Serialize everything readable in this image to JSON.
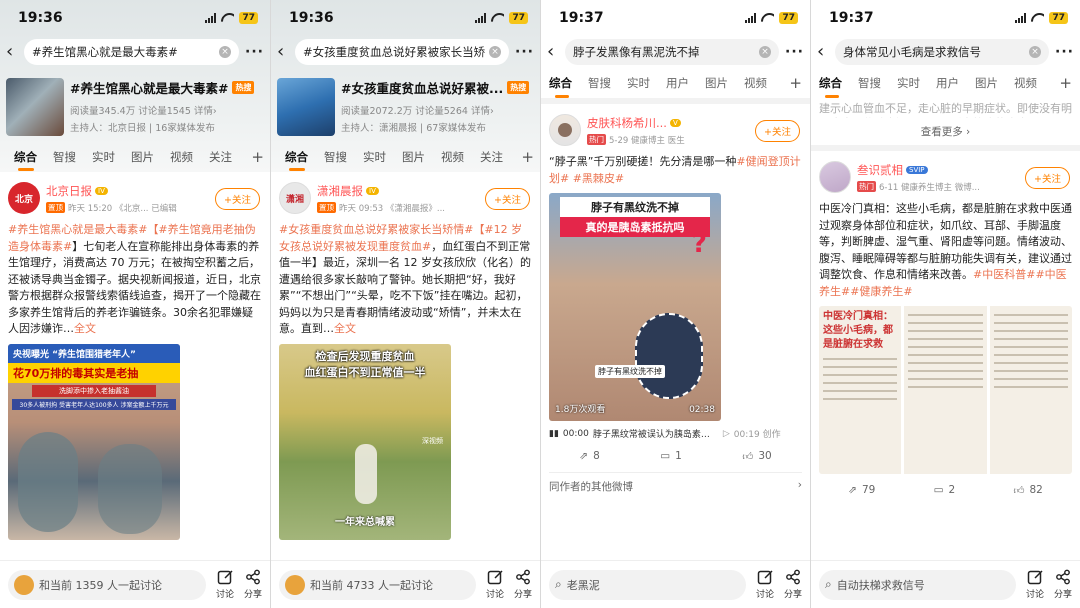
{
  "screens": [
    {
      "time": "19:36",
      "battery": "77",
      "search_query": "#养生馆黑心就是最大毒素#",
      "topic": {
        "title": "#养生馆黑心就是最大毒素#",
        "hot_label": "热搜",
        "stats": "阅读量345.4万  讨论量1545  详情›",
        "host": "主持人：北京日报 | 16家媒体发布"
      },
      "tabs": [
        "综合",
        "智搜",
        "实时",
        "图片",
        "视频",
        "关注"
      ],
      "post": {
        "author": "北京日报",
        "author_badge": "IV",
        "meta_tag": "置顶",
        "meta": "昨天 15:20 《北京... 已编辑",
        "follow_label": "+关注",
        "text_link1": "#养生馆黑心就是最大毒素#",
        "text_link2": "【#养生馆竟用老抽伪造身体毒素#",
        "text_body": "】七旬老人在宣称能排出身体毒素的养生馆理疗，消费高达 70 万元；在被掏空积蓄之后，还被诱导典当金镯子。据央视新闻报道，近日，北京警方根据群众报警线索循线追查，揭开了一个隐藏在多家养生馆背后的养老诈骗链条。30余名犯罪嫌疑人因涉嫌诈…",
        "fulltext": "全文",
        "image_title1": "央视曝光 “养生馆围猎老年人”",
        "image_title2": "花70万排的毒其实是老抽",
        "image_sub1": "洗脚添中掺入老抽酱油",
        "image_sub2": "30多人被刑拘 受害老年人达100多人 涉案金额上千万元"
      },
      "discuss": "和当前 1359 人一起讨论",
      "btn_discuss": "讨论",
      "btn_share": "分享"
    },
    {
      "time": "19:36",
      "battery": "77",
      "search_query": "#女孩重度贫血总说好累被家长当矫",
      "topic": {
        "title": "#女孩重度贫血总说好累被...",
        "hot_label": "热搜",
        "stats": "阅读量2072.2万  讨论量5264  详情›",
        "host": "主持人：潇湘晨报 | 67家媒体发布"
      },
      "tabs": [
        "综合",
        "智搜",
        "实时",
        "图片",
        "视频",
        "关注"
      ],
      "post": {
        "author": "潇湘晨报",
        "author_badge": "IV",
        "meta_tag": "置顶",
        "meta": "昨天 09:53 《潇湘晨报》...",
        "follow_label": "+关注",
        "text_link1": "#女孩重度贫血总说好累被家长当矫情#",
        "text_link2": "【#12 岁女孩总说好累被发现重度贫血#",
        "text_body": "，血红蛋白不到正常值一半】最近，深圳一名 12 岁女孩欣欣（化名）的遭遇给很多家长敲响了警钟。她长期把“好，我好累”“不想出门”“头晕，吃不下饭”挂在嘴边。起初，妈妈以为只是青春期情绪波动或“矫情”，并未太在意。直到…",
        "fulltext": "全文",
        "image_title1": "检查后发现重度贫血",
        "image_title2": "血红蛋白不到正常值一半",
        "image_caption": "一年来总喊累",
        "watermark": "深视频"
      },
      "discuss": "和当前 4733 人一起讨论",
      "btn_discuss": "讨论",
      "btn_share": "分享"
    },
    {
      "time": "19:37",
      "battery": "77",
      "search_query": "脖子发黑像有黑泥洗不掉",
      "tabs": [
        "综合",
        "智搜",
        "实时",
        "用户",
        "图片",
        "视频"
      ],
      "post": {
        "author": "皮肤科杨希川...",
        "meta_tag": "热门",
        "meta": "5-29  健康博主 医生",
        "follow_label": "+关注",
        "text_pre": "“脖子黑”千万别硬搓！先分清是哪一种",
        "text_link1": "#健闻登顶计划#",
        "text_link2": "#黑棘皮#",
        "video_title1": "脖子有黑纹洗不掉",
        "video_title2": "真的是胰岛素抵抗吗",
        "video_caption": "脖子有黑纹洗不掉",
        "views": "1.8万次观看",
        "duration": "02:38",
        "audio_time": "00:00",
        "audio_title": "脖子黑纹常被误认为胰岛素抵抗...",
        "audio_end": "00:19 创作",
        "reposts": "8",
        "comments": "1",
        "likes": "30"
      },
      "section": "同作者的其他微博",
      "search_placeholder": "老黑泥",
      "btn_discuss": "讨论",
      "btn_share": "分享"
    },
    {
      "time": "19:37",
      "battery": "77",
      "search_query": "身体常见小毛病是求救信号",
      "tabs": [
        "综合",
        "智搜",
        "实时",
        "用户",
        "图片",
        "视频"
      ],
      "top_text": "建示心血管血不足，走心脏的早期症状。即使没有明显疼痛，伴随出汗、恶心、乏力等症状也应",
      "see_more": "查看更多 ›",
      "post": {
        "author": "叁识贰相",
        "author_badge": "SVIP",
        "meta_tag": "热门",
        "meta": "6-11  健康养生博主 微博...",
        "follow_label": "+关注",
        "text_body": "中医冷门真相：这些小毛病，都是脏腑在求救中医通过观察身体部位和症状，如爪纹、耳部、手脚温度等，判断脾虚、湿气重、肾阳虚等问题。情绪波动、腹泻、睡眠障碍等都与脏腑功能失调有关，建议通过调整饮食、作息和情绪来改善。",
        "text_link1": "#中医科普#",
        "text_link2": "#中医养生#",
        "text_link3": "#健康养生#",
        "img_title": "中医冷门真相：这些小毛病，都是脏腑在求救",
        "reposts": "79",
        "comments": "2",
        "likes": "82"
      },
      "search_placeholder": "自动扶梯求救信号",
      "btn_discuss": "讨论",
      "btn_share": "分享"
    }
  ],
  "colors": {
    "accent": "#ff8200",
    "link": "#eb7350",
    "author_red": "#ff5555"
  }
}
